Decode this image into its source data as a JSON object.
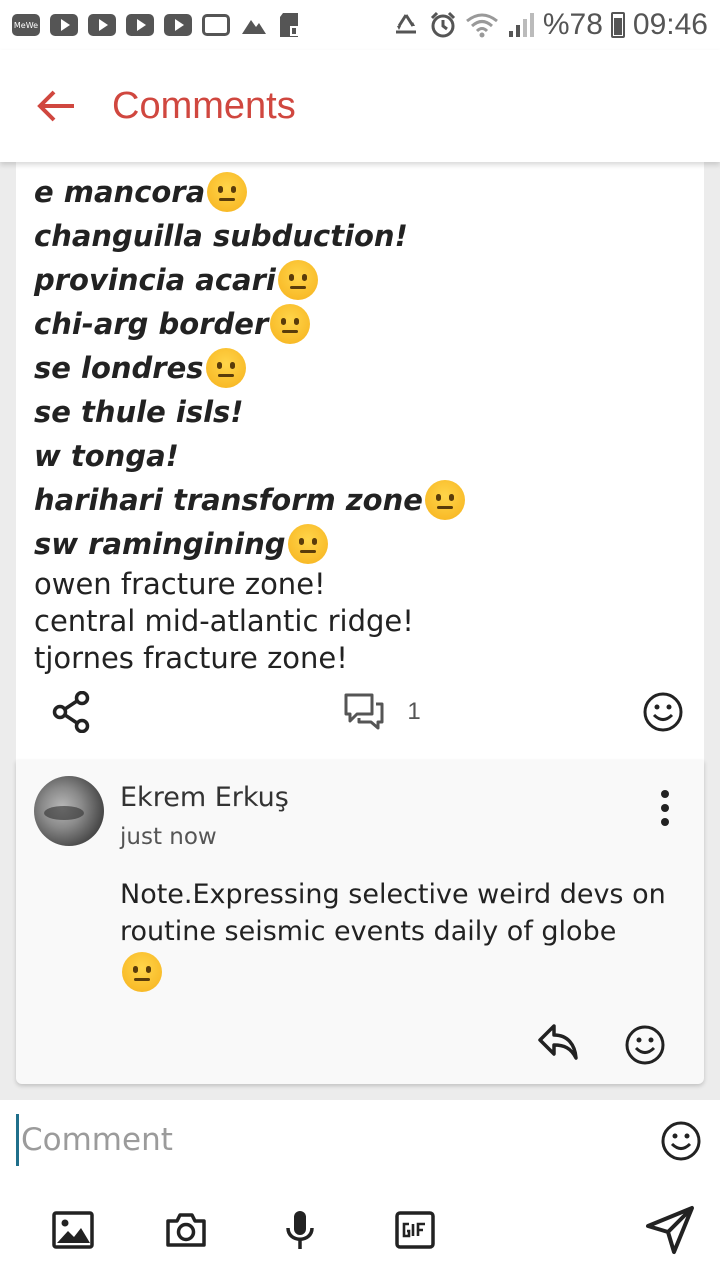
{
  "status_bar": {
    "left_icons": [
      "mewe-icon",
      "youtube-icon",
      "youtube-icon",
      "youtube-icon",
      "youtube-icon",
      "gallery-icon",
      "mountain-icon",
      "sd-card-icon"
    ],
    "right_icons": [
      "recycle-icon",
      "alarm-icon",
      "wifi-icon",
      "signal-icon"
    ],
    "battery": "%78",
    "time": "09:46"
  },
  "app_bar": {
    "title": "Comments",
    "accent_color": "#d0473f"
  },
  "post": {
    "lines": [
      {
        "text": "e mancora",
        "emoji": true,
        "style": "bold"
      },
      {
        "text": "changuilla subduction!",
        "emoji": false,
        "style": "bold"
      },
      {
        "text": "provincia acari",
        "emoji": true,
        "style": "bold"
      },
      {
        "text": "chi-arg border",
        "emoji": true,
        "style": "bold"
      },
      {
        "text": "se londres",
        "emoji": true,
        "style": "bold"
      },
      {
        "text": "se thule isls!",
        "emoji": false,
        "style": "bold"
      },
      {
        "text": "w tonga!",
        "emoji": false,
        "style": "bold"
      },
      {
        "text": "harihari transform zone",
        "emoji": true,
        "style": "bold"
      },
      {
        "text": "sw ramingining",
        "emoji": true,
        "style": "bold"
      },
      {
        "text": "owen fracture zone!",
        "emoji": false,
        "style": "plain"
      },
      {
        "text": "central mid-atlantic ridge!",
        "emoji": false,
        "style": "plain"
      },
      {
        "text": "tjornes fracture zone!",
        "emoji": false,
        "style": "plain"
      }
    ],
    "comment_count": "1"
  },
  "comment": {
    "author": "Ekrem Erkuş",
    "time": "just now",
    "text": "Note.Expressing selective weird devs on routine seismic events daily of globe"
  },
  "composer": {
    "placeholder": "Comment",
    "value": ""
  }
}
